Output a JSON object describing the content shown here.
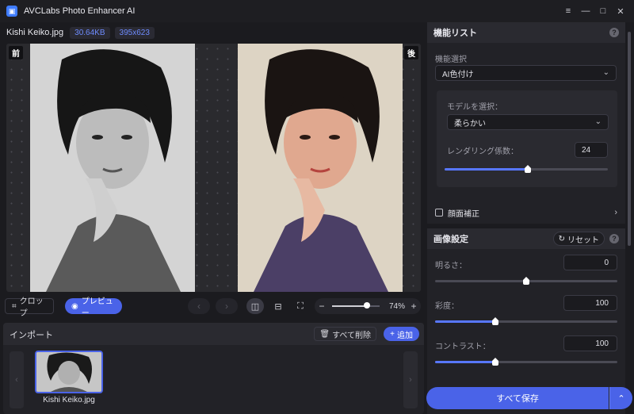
{
  "app": {
    "title": "AVCLabs Photo Enhancer AI"
  },
  "window": {
    "menu_icon": "menu-icon",
    "minimize_icon": "minimize-icon",
    "maximize_icon": "maximize-icon",
    "close_icon": "close-icon"
  },
  "file": {
    "name": "Kishi Keiko.jpg",
    "size": "30.64KB",
    "dimensions": "395x623"
  },
  "canvas": {
    "before_label": "前",
    "after_label": "後"
  },
  "toolbar": {
    "crop_label": "クロップ",
    "preview_label": "プレビュー",
    "zoom_value": "74%",
    "zoom_level": 0.74
  },
  "import": {
    "title": "インポート",
    "clear_label": "すべて削除",
    "add_label": "追加",
    "items": [
      {
        "name": "Kishi Keiko.jpg"
      }
    ]
  },
  "features": {
    "title": "機能リスト",
    "function_select_label": "機能選択",
    "function_value": "AI色付け",
    "model_label": "モデルを選択：",
    "model_value": "柔らかい",
    "rendering_label": "レンダリング係数：",
    "rendering_value": "24",
    "face_label": "顔面補正"
  },
  "image_settings": {
    "title": "画像設定",
    "reset_label": "リセット",
    "brightness_label": "明るさ：",
    "brightness_value": "0",
    "saturation_label": "彩度：",
    "saturation_value": "100",
    "contrast_label": "コントラスト：",
    "contrast_value": "100"
  },
  "save": {
    "label": "すべて保存"
  },
  "colors": {
    "accent": "#4a63e8",
    "chip_text": "#6e8cff"
  }
}
